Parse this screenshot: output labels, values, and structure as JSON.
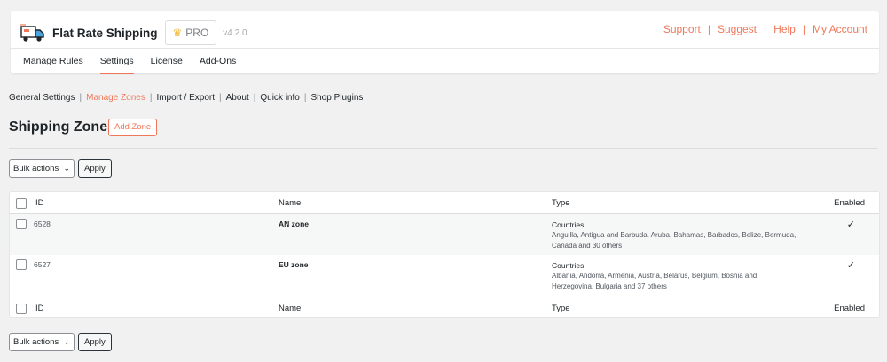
{
  "header": {
    "plugin_name": "Flat Rate Shipping",
    "badge": "PRO",
    "version": "v4.2.0",
    "links": [
      "Support",
      "Suggest",
      "Help",
      "My Account"
    ],
    "link_separator": "|"
  },
  "main_tabs": [
    {
      "label": "Manage Rules",
      "active": false
    },
    {
      "label": "Settings",
      "active": true
    },
    {
      "label": "License",
      "active": false
    },
    {
      "label": "Add-Ons",
      "active": false
    }
  ],
  "sub_nav": [
    {
      "label": "General Settings",
      "current": false
    },
    {
      "label": "Manage Zones",
      "current": true
    },
    {
      "label": "Import / Export",
      "current": false
    },
    {
      "label": "About",
      "current": false
    },
    {
      "label": "Quick info",
      "current": false
    },
    {
      "label": "Shop Plugins",
      "current": false
    }
  ],
  "page": {
    "title": "Shipping Zones",
    "add_button": "Add Zone"
  },
  "bulk": {
    "select_value": "Bulk actions",
    "apply_label": "Apply"
  },
  "table": {
    "columns": {
      "id": "ID",
      "name": "Name",
      "type": "Type",
      "enabled": "Enabled"
    },
    "rows": [
      {
        "id": "6528",
        "name": "AN zone",
        "type": "Countries",
        "type_detail_line1": "Anguilla, Antigua and Barbuda, Aruba, Bahamas, Barbados, Belize, Bermuda,",
        "type_detail_line2": "Canada and 30 others",
        "enabled": "✓"
      },
      {
        "id": "6527",
        "name": "EU zone",
        "type": "Countries",
        "type_detail_line1": "Albania, Andorra, Armenia, Austria, Belarus, Belgium, Bosnia and",
        "type_detail_line2": "Herzegovina, Bulgaria and 37 others",
        "enabled": "✓"
      }
    ]
  },
  "colors": {
    "accent": "#f0785a",
    "background": "#f1f1f1",
    "text": "#1d2327"
  },
  "icons": {
    "logo": "delivery-truck-icon",
    "badge": "crown-icon",
    "select": "chevron-down-icon"
  }
}
